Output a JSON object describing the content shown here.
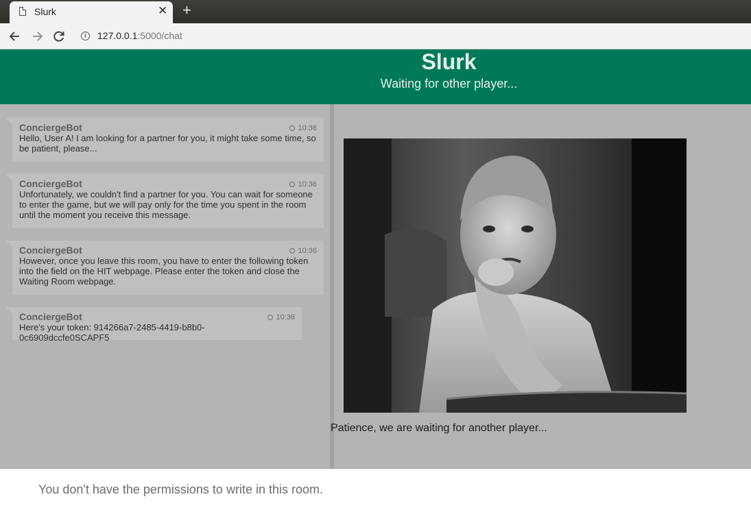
{
  "browser": {
    "tab_title": "Slurk",
    "url_host": "127.0.0.1",
    "url_path": ":5000/chat"
  },
  "header": {
    "title": "Slurk",
    "subtitle": "Waiting for other player..."
  },
  "messages": [
    {
      "user": "ConciergeBot",
      "time": "10:36",
      "text": "Hello, User A! I am looking for a partner for you, it might take some time, so be patient, please..."
    },
    {
      "user": "ConciergeBot",
      "time": "10:36",
      "text": "Unfortunately, we couldn't find a partner for you. You can wait for someone to enter the game, but we will pay only for the time you spent in the room until the moment you receive this message."
    },
    {
      "user": "ConciergeBot",
      "time": "10:36",
      "text": "However, once you leave this room, you have to enter the following token into the field on the HIT webpage. Please enter the token and close the Waiting Room webpage."
    },
    {
      "user": "ConciergeBot",
      "time": "10:36",
      "text": "Here's your token: 914266a7-2485-4419-b8b0-0c6909dccfe0SCAPF5"
    }
  ],
  "side": {
    "caption": "Patience, we are waiting for another player..."
  },
  "footer": {
    "notice": "You don't have the permissions to write in this room."
  },
  "colors": {
    "header_bg": "#00795a",
    "content_bg": "#b3b4b6",
    "message_bg": "#bebfc1"
  },
  "icons": [
    "page-icon",
    "close-icon",
    "plus-icon",
    "back-arrow-icon",
    "forward-arrow-icon",
    "reload-icon",
    "info-icon",
    "clock-icon"
  ]
}
